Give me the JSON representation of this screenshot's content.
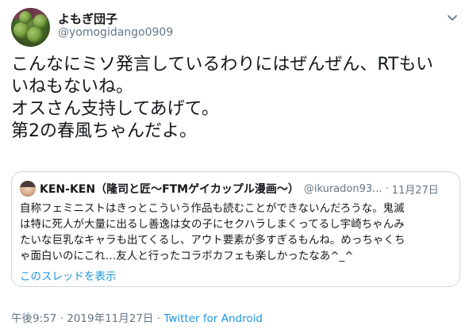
{
  "author": {
    "display_name": "よもぎ団子",
    "screen_name": "@yomogidango0909"
  },
  "tweet": {
    "lines": [
      "こんなにミソ発言しているわりにはぜんぜん、RTもい",
      "いねもないね。",
      "オスさん支持してあげて。",
      "第2の春風ちゃんだよ。"
    ]
  },
  "quote": {
    "display_name": "KEN-KEN（隆司と匠〜FTMゲイカップル漫画〜）",
    "screen_name": "@ikuradon93...",
    "separator": "·",
    "date": "11月27日",
    "lines": [
      "自称フェミニストはきっとこういう作品も読むことができないんだろうな。鬼滅",
      "は特に死人が大量に出るし善逸は女の子にセクハラしまくってるし宇崎ちゃんみ",
      "たいな巨乳なキャラも出てくるし、アウト要素が多すぎるもんね。めっちゃくち",
      "ゃ面白いのにこれ…友人と行ったコラボカフェも楽しかったなあ^_^"
    ],
    "thread_link": "このスレッドを表示"
  },
  "footer": {
    "time": "午後9:57",
    "separator": "·",
    "date": "2019年11月27日",
    "app": "Twitter for Android"
  },
  "colors": {
    "text": "#14171a",
    "secondary": "#657786",
    "link": "#1b95e0",
    "border": "#ccd6dd"
  },
  "icons": {
    "caret": "chevron-down-icon"
  }
}
